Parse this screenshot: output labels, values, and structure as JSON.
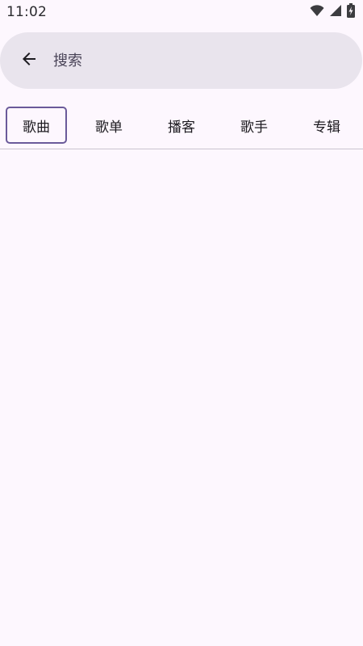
{
  "status_bar": {
    "time": "11:02",
    "icons": [
      "wifi-icon",
      "cellular-signal-icon",
      "battery-charging-icon"
    ]
  },
  "search": {
    "back_icon": "arrow-back-icon",
    "placeholder": "搜索",
    "value": ""
  },
  "tabs": [
    {
      "label": "歌曲",
      "selected": true
    },
    {
      "label": "歌单",
      "selected": false
    },
    {
      "label": "播客",
      "selected": false
    },
    {
      "label": "歌手",
      "selected": false
    },
    {
      "label": "专辑",
      "selected": false
    }
  ],
  "colors": {
    "background": "#fdf7fe",
    "search_bar": "#e9e4ed",
    "selected_tab_border": "#6a5a9a",
    "divider": "#cac4d0"
  }
}
